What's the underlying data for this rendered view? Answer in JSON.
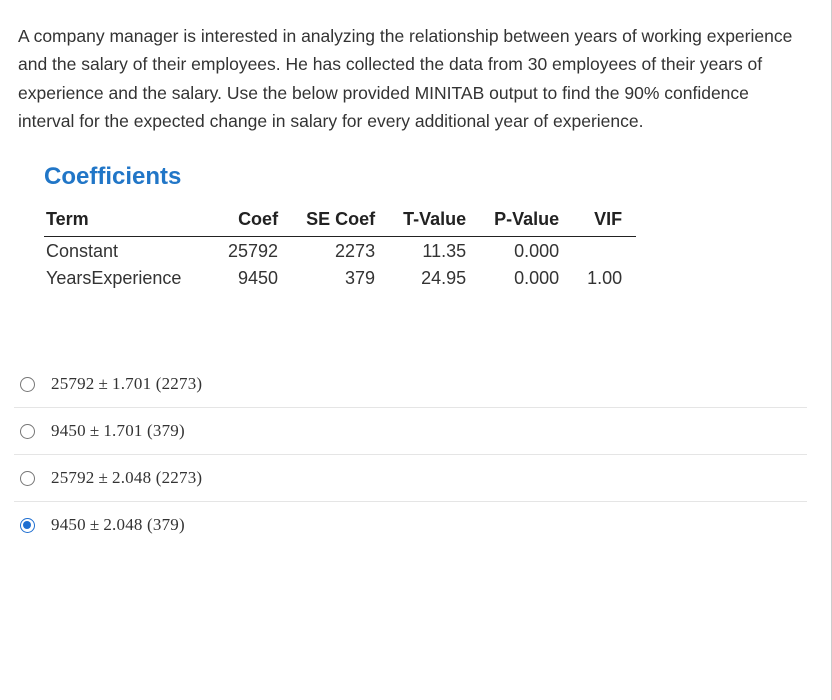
{
  "question": "A company manager is interested in analyzing the relationship between years of working experience and the salary of their employees. He has collected the data from 30 employees of their years of experience and the salary. Use the below provided MINITAB output to find the 90% confidence interval for the expected change in salary for every additional year of experience.",
  "coeff_title": "Coefficients",
  "headers": {
    "term": "Term",
    "coef": "Coef",
    "se": "SE Coef",
    "t": "T-Value",
    "p": "P-Value",
    "vif": "VIF"
  },
  "rows": [
    {
      "term": "Constant",
      "coef": "25792",
      "se": "2273",
      "t": "11.35",
      "p": "0.000",
      "vif": ""
    },
    {
      "term": "YearsExperience",
      "coef": "9450",
      "se": "379",
      "t": "24.95",
      "p": "0.000",
      "vif": "1.00"
    }
  ],
  "options": [
    {
      "a": "25792",
      "b": "1.701",
      "c": "2273",
      "selected": false
    },
    {
      "a": "9450",
      "b": "1.701",
      "c": "379",
      "selected": false
    },
    {
      "a": "25792",
      "b": "2.048",
      "c": "2273",
      "selected": false
    },
    {
      "a": "9450",
      "b": "2.048",
      "c": "379",
      "selected": true
    }
  ]
}
